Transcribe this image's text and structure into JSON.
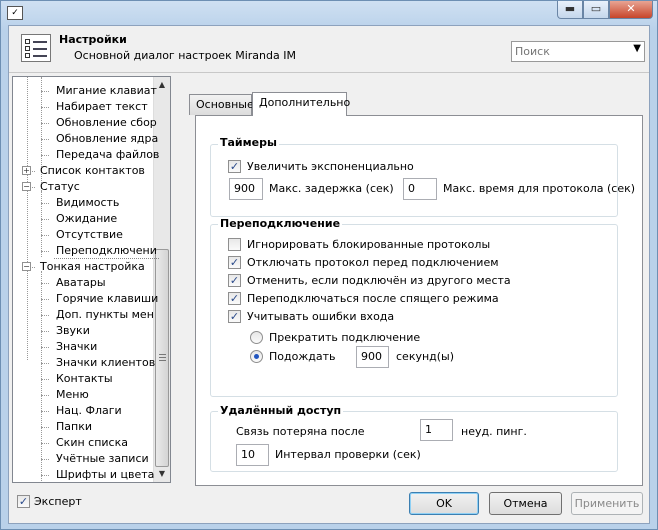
{
  "titlebar": {
    "icon": "settings-app-icon",
    "buttons": [
      {
        "name": "minimize",
        "glyph": "▬"
      },
      {
        "name": "maximize",
        "glyph": "▭"
      },
      {
        "name": "close",
        "glyph": "✕"
      }
    ]
  },
  "header": {
    "title": "Настройки",
    "subtitle": "Основной диалог настроек Miranda IM",
    "search_placeholder": "Поиск"
  },
  "tree": {
    "items": [
      {
        "label": "Мигание клавиат",
        "level": 2
      },
      {
        "label": "Набирает текст",
        "level": 2
      },
      {
        "label": "Обновление сбор",
        "level": 2
      },
      {
        "label": "Обновление ядра",
        "level": 2
      },
      {
        "label": "Передача файлов",
        "level": 2
      },
      {
        "label": "Список контактов",
        "level": 1,
        "expander": "+"
      },
      {
        "label": "Статус",
        "level": 1,
        "expander": "−"
      },
      {
        "label": "Видимость",
        "level": 2
      },
      {
        "label": "Ожидание",
        "level": 2
      },
      {
        "label": "Отсутствие",
        "level": 2
      },
      {
        "label": "Переподключени",
        "level": 2,
        "selected": true
      },
      {
        "label": "Тонкая настройка",
        "level": 1,
        "expander": "−"
      },
      {
        "label": "Аватары",
        "level": 2
      },
      {
        "label": "Горячие клавиши",
        "level": 2
      },
      {
        "label": "Доп. пункты мен",
        "level": 2
      },
      {
        "label": "Звуки",
        "level": 2
      },
      {
        "label": "Значки",
        "level": 2
      },
      {
        "label": "Значки клиентов",
        "level": 2
      },
      {
        "label": "Контакты",
        "level": 2
      },
      {
        "label": "Меню",
        "level": 2
      },
      {
        "label": "Нац. Флаги",
        "level": 2
      },
      {
        "label": "Папки",
        "level": 2
      },
      {
        "label": "Скин списка",
        "level": 2
      },
      {
        "label": "Учётные записи",
        "level": 2
      },
      {
        "label": "Шрифты и цвета",
        "level": 2
      }
    ]
  },
  "tabs": [
    {
      "label": "Основные",
      "active": false
    },
    {
      "label": "Дополнительно",
      "active": true
    }
  ],
  "timers": {
    "title": "Таймеры",
    "exponential_label": "Увеличить экспоненциально",
    "exponential_checked": true,
    "max_delay_value": "900",
    "max_delay_label": "Макс. задержка (сек)",
    "max_log_value": "0",
    "max_log_label": "Макс. время для протокола (сек)"
  },
  "reconnect": {
    "title": "Переподключение",
    "options": [
      {
        "label": "Игнорировать блокированные протоколы",
        "checked": false
      },
      {
        "label": "Отключать протокол перед подключением",
        "checked": true
      },
      {
        "label": "Отменить, если подключён из другого места",
        "checked": true
      },
      {
        "label": "Переподключаться после спящего режима",
        "checked": true
      },
      {
        "label": "Учитывать ошибки входа",
        "checked": true
      }
    ],
    "radio_stop_label": "Прекратить подключение",
    "radio_wait_label": "Подождать",
    "wait_value": "900",
    "wait_unit": "секунд(ы)",
    "selected_radio": "wait"
  },
  "remote": {
    "title": "Удалённый доступ",
    "lost_label": "Связь потеряна после",
    "lost_value": "1",
    "lost_unit": "неуд. пинг.",
    "interval_value": "10",
    "interval_label": "Интервал проверки (сек)"
  },
  "footer": {
    "expert_label": "Эксперт",
    "expert_checked": true,
    "ok_label": "OK",
    "cancel_label": "Отмена",
    "apply_label": "Применить"
  },
  "glyphs": {
    "check": "✓",
    "dropdown": "▼",
    "scroll_up": "▲",
    "scroll_down": "▼"
  }
}
